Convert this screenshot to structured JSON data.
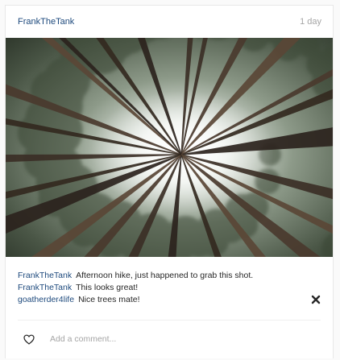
{
  "post": {
    "author": "FrankTheTank",
    "time": "1 day",
    "photo_subject": "upward view of tall pine tree trunks converging toward a bright sky"
  },
  "comments": [
    {
      "user": "FrankTheTank",
      "text": "Afternoon hike, just happened to grab this shot."
    },
    {
      "user": "FrankTheTank",
      "text": "This looks great!"
    },
    {
      "user": "goatherder4life",
      "text": "Nice trees mate!",
      "deletable": true
    }
  ],
  "footer": {
    "like_icon": "heart-outline-icon",
    "comment_placeholder": "Add a comment..."
  },
  "icons": {
    "delete": "close-icon"
  },
  "colors": {
    "username": "#1e4a7d",
    "timestamp": "#a5a5a5",
    "text": "#262626"
  }
}
